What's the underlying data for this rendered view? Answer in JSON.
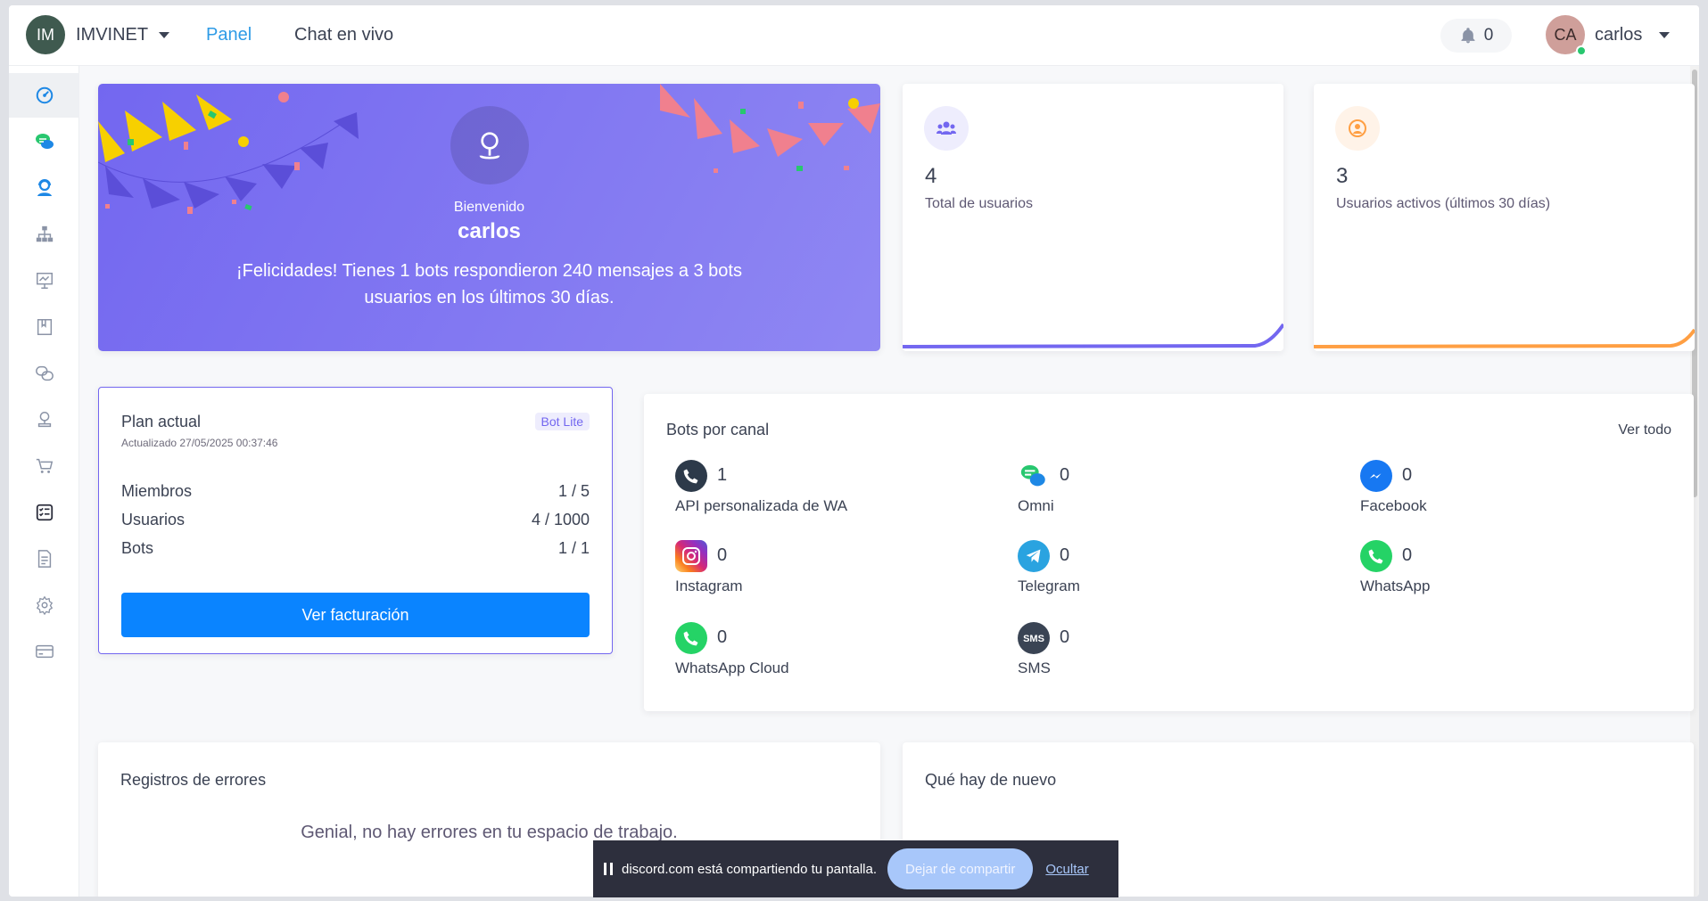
{
  "header": {
    "logo_initials": "IM",
    "brand": "IMVINET",
    "nav": [
      {
        "label": "Panel",
        "active": true
      },
      {
        "label": "Chat en vivo",
        "active": false
      }
    ],
    "notifications_count": "0",
    "user_initials": "CA",
    "user_name": "carlos"
  },
  "sidebar": {
    "items": [
      {
        "icon": "dashboard-icon",
        "active": true
      },
      {
        "icon": "chat-bubbles-icon"
      },
      {
        "icon": "live-agent-icon"
      },
      {
        "icon": "org-chart-icon"
      },
      {
        "icon": "presentation-icon"
      },
      {
        "icon": "book-icon"
      },
      {
        "icon": "linked-chats-icon"
      },
      {
        "icon": "user-stamp-icon"
      },
      {
        "icon": "cart-icon"
      },
      {
        "icon": "checklist-icon"
      },
      {
        "icon": "document-icon"
      },
      {
        "icon": "settings-icon"
      },
      {
        "icon": "credit-card-icon"
      }
    ]
  },
  "welcome": {
    "label": "Bienvenido",
    "name": "carlos",
    "message": "¡Felicidades! Tienes 1 bots respondieron 240 mensajes a 3 bots usuarios en los últimos 30 días."
  },
  "stats": [
    {
      "value": "4",
      "label": "Total de usuarios",
      "icon": "users-icon",
      "color": "#7367f0"
    },
    {
      "value": "3",
      "label": "Usuarios activos (últimos 30 días)",
      "icon": "user-circle-icon",
      "color": "#ff9f43"
    }
  ],
  "plan": {
    "title": "Plan actual",
    "updated": "Actualizado 27/05/2025 00:37:46",
    "badge": "Bot Lite",
    "rows": [
      {
        "label": "Miembros",
        "value": "1 / 5"
      },
      {
        "label": "Usuarios",
        "value": "4 / 1000"
      },
      {
        "label": "Bots",
        "value": "1 / 1"
      }
    ],
    "button": "Ver facturación"
  },
  "channels": {
    "title": "Bots por canal",
    "view_all": "Ver todo",
    "items": [
      {
        "name": "API personalizada de WA",
        "count": "1",
        "icon": "whatsapp-api-icon"
      },
      {
        "name": "Omni",
        "count": "0",
        "icon": "omni-icon"
      },
      {
        "name": "Facebook",
        "count": "0",
        "icon": "messenger-icon"
      },
      {
        "name": "Instagram",
        "count": "0",
        "icon": "instagram-icon"
      },
      {
        "name": "Telegram",
        "count": "0",
        "icon": "telegram-icon"
      },
      {
        "name": "WhatsApp",
        "count": "0",
        "icon": "whatsapp-icon"
      },
      {
        "name": "WhatsApp Cloud",
        "count": "0",
        "icon": "whatsapp-cloud-icon"
      },
      {
        "name": "SMS",
        "count": "0",
        "icon": "sms-icon"
      }
    ]
  },
  "errors": {
    "title": "Registros de errores",
    "message": "Genial, no hay errores en tu espacio de trabajo."
  },
  "news": {
    "title": "Qué hay de nuevo"
  },
  "share_bar": {
    "text": "discord.com está compartiendo tu pantalla.",
    "stop": "Dejar de compartir",
    "hide": "Ocultar"
  },
  "colors": {
    "primary": "#7367f0",
    "link": "#2e9be6",
    "button": "#0a84ff",
    "orange": "#ff9f43"
  }
}
